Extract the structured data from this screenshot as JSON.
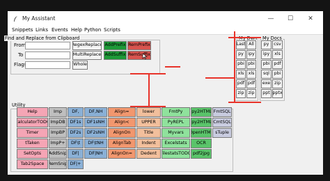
{
  "window": {
    "title": "My Assistant",
    "minimize": "—",
    "maximize": "☐",
    "close": "✕"
  },
  "menu": [
    "Snippets",
    "Links",
    "Events",
    "Help",
    "Python",
    "Scripts"
  ],
  "find_replace": {
    "group_label": "Find and Replace from Clipboard",
    "from_label": "From",
    "to_label": "To",
    "flags_label": "Flags",
    "from_value": "",
    "to_value": "",
    "flags_value": "",
    "buttons": {
      "regex_replace": "RegexReplace",
      "multi_replace": "MultiReplace",
      "whole": "Whole",
      "add_prefix": "AddPrefix",
      "rem_prefix": "RemPrefix",
      "add_suffix": "AddSuffix",
      "rem_suffix": "RemSuffix"
    }
  },
  "my_dwn": {
    "label": "My Dwn",
    "buttons": [
      "Last",
      "All",
      "py",
      "ipy",
      "pbi",
      "pbi",
      "xls",
      "xls",
      "pdf",
      "pdf",
      "zip",
      "zip"
    ]
  },
  "my_docs": {
    "label": "My Docs",
    "buttons": [
      "py",
      "csv",
      "ipy",
      "xls",
      "pbi",
      "pdf",
      "sql",
      "pbi",
      "exe",
      "zip",
      "ppt",
      "pptx"
    ]
  },
  "utility": {
    "label": "Utility",
    "columns": [
      [
        "Help",
        "CalculatorTODO",
        "Timer",
        "tTaken",
        "SetOpts",
        "Tab2Space"
      ],
      [
        "Imp",
        "ImpDB",
        "ImpBP",
        "ImpP+",
        "AddSnip",
        "RemSnip"
      ],
      [
        "DF,",
        "DF1s",
        "DF2s",
        "DF\\t",
        "DF|",
        "DF|+"
      ],
      [
        "DF,NH",
        "DF1sNH",
        "DF2sNH",
        "DF\\tNH",
        "DF|NH"
      ],
      [
        "Align=",
        "Align<",
        "AlignOn",
        "AlignTab",
        "AlignOn="
      ],
      [
        "lower",
        "UPPER",
        "Title",
        "Indent",
        "Dedent"
      ],
      [
        "FmtPy",
        "PyREPL",
        "Myvars",
        "Excelstats",
        "FilestatsTODO"
      ],
      [
        "Ipy2HTML",
        "Ipy2HTML",
        "OpenHTML",
        "OCR",
        "pdf2jpg"
      ],
      [
        "FmtSQL",
        "CmtSQL",
        "sTuple"
      ]
    ]
  },
  "colors": {
    "pink": "#f5a5b5",
    "gray": "#bfbfbf",
    "blue": "#8ab0d6",
    "orange": "#f2976e",
    "peach": "#f2bf9c",
    "light_green": "#8fe29c",
    "green": "#5ac46a",
    "lavender": "#c9cce0",
    "dark_green": "#1e9a38",
    "red": "#d9544f",
    "annotation_red": "#e8332a"
  }
}
